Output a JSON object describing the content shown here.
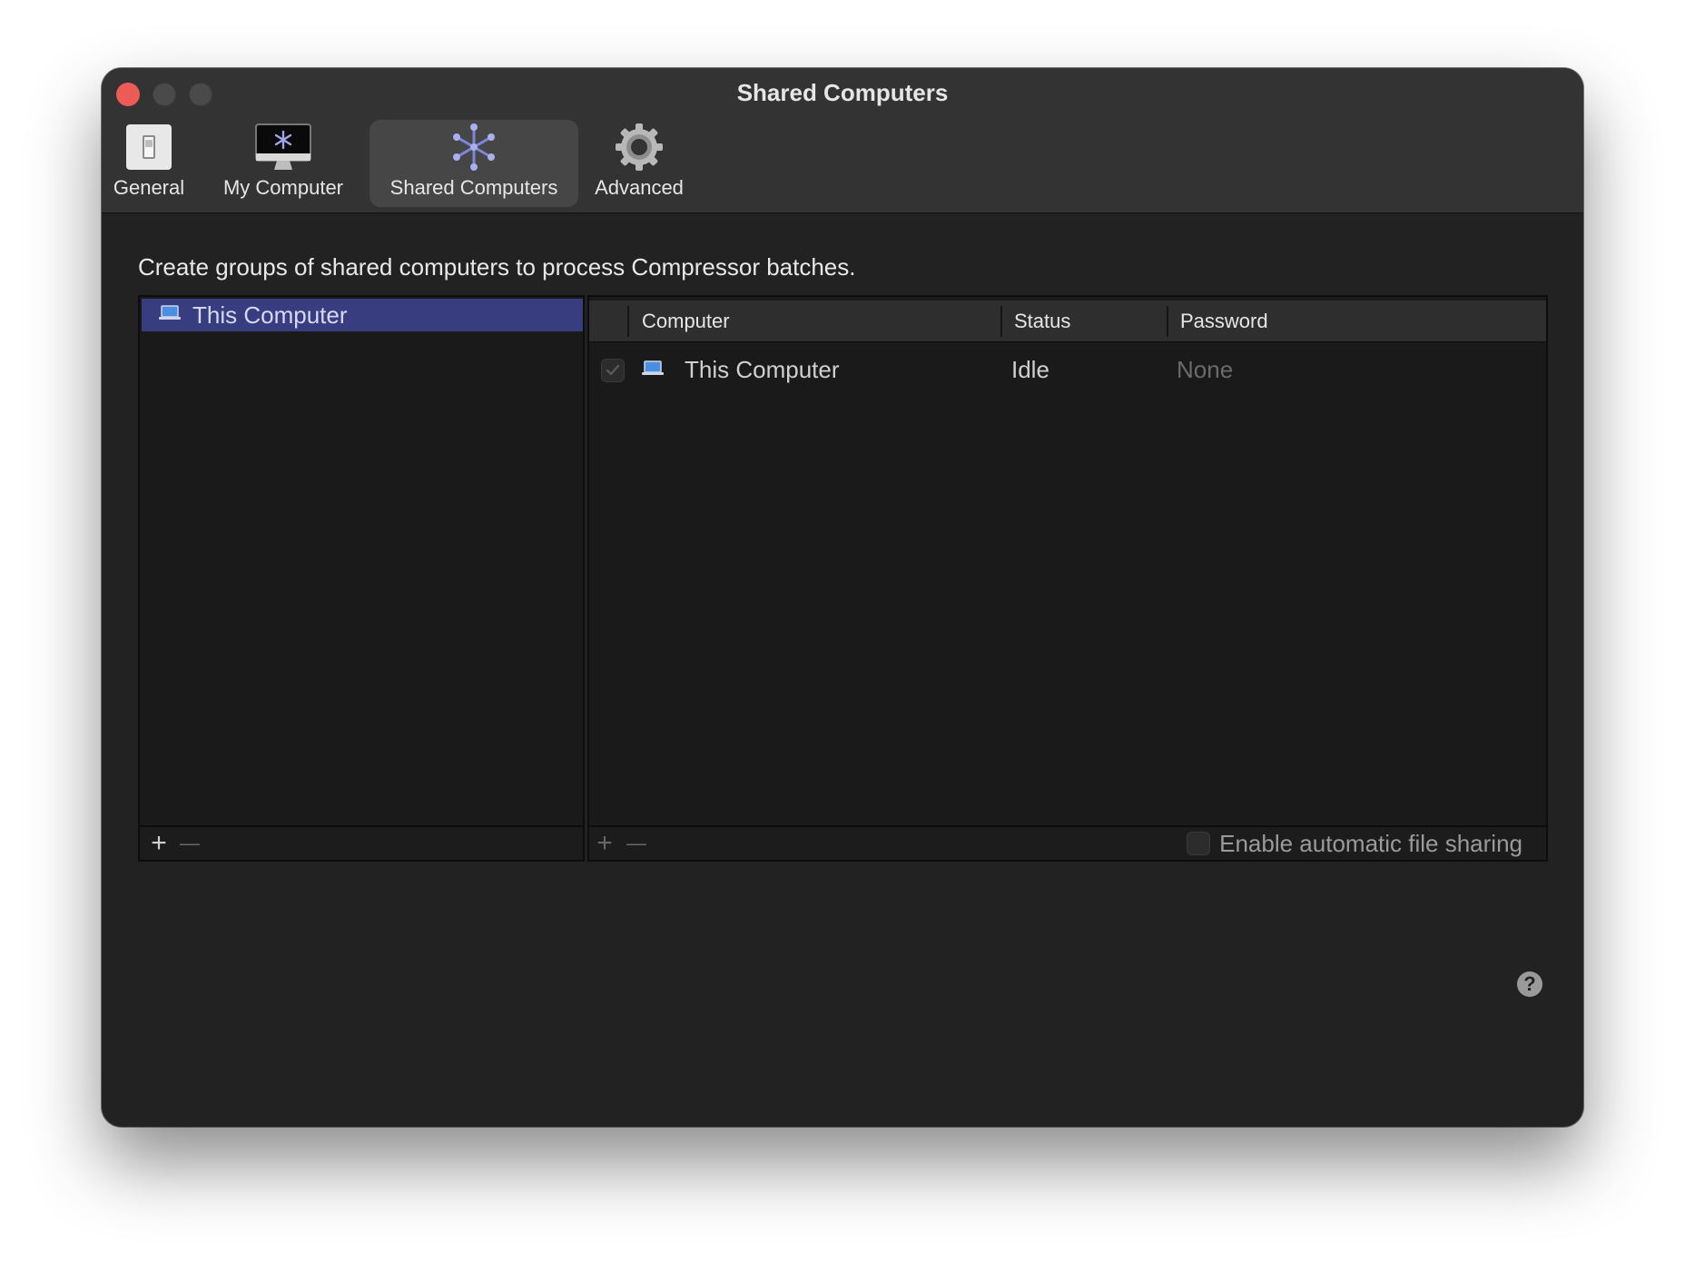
{
  "window": {
    "title": "Shared Computers"
  },
  "toolbar": {
    "items": [
      {
        "label": "General",
        "icon": "switch-icon",
        "selected": false
      },
      {
        "label": "My Computer",
        "icon": "imac-icon",
        "selected": false
      },
      {
        "label": "Shared Computers",
        "icon": "network-icon",
        "selected": true
      },
      {
        "label": "Advanced",
        "icon": "gear-icon",
        "selected": false
      }
    ]
  },
  "description": "Create groups of shared computers to process Compressor batches.",
  "groups": {
    "items": [
      {
        "label": "This Computer",
        "icon": "laptop-icon",
        "selected": true
      }
    ],
    "add_label": "+",
    "remove_label": "—"
  },
  "computers": {
    "columns": {
      "computer": "Computer",
      "status": "Status",
      "password": "Password"
    },
    "rows": [
      {
        "checked": true,
        "name": "This Computer",
        "status": "Idle",
        "password": "None"
      }
    ],
    "add_label": "+",
    "remove_label": "—",
    "auto_share_label": "Enable automatic file sharing",
    "auto_share_checked": false
  },
  "help": {
    "label": "?"
  },
  "colors": {
    "accent_selected": "#383d80",
    "close": "#ed5b55",
    "window_bg": "#222222"
  }
}
